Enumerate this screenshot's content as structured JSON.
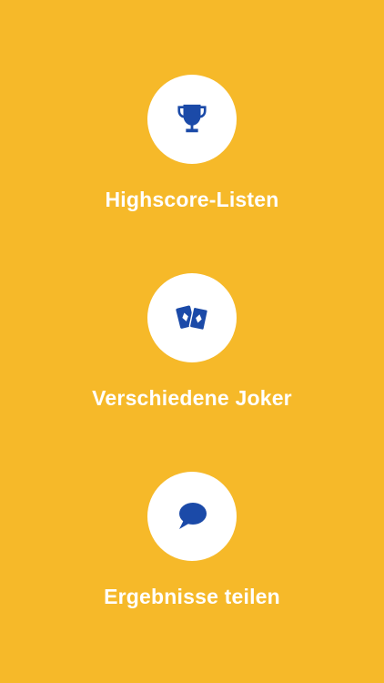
{
  "colors": {
    "background": "#F6B929",
    "circle": "#FFFFFF",
    "icon": "#1B4AA8",
    "text": "#FFFFFF"
  },
  "features": [
    {
      "icon": "trophy-icon",
      "label": "Highscore-Listen"
    },
    {
      "icon": "cards-icon",
      "label": "Verschiedene Joker"
    },
    {
      "icon": "speech-bubble-icon",
      "label": "Ergebnisse teilen"
    }
  ]
}
